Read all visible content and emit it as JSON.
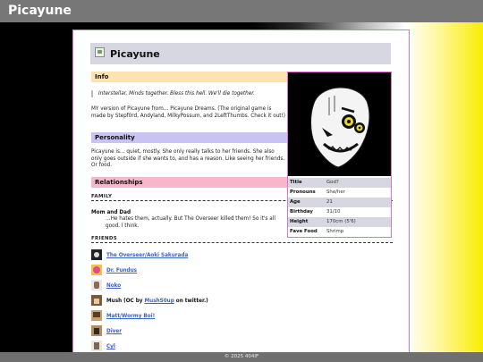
{
  "site": {
    "title": "Picayune"
  },
  "page": {
    "title": "Picayune"
  },
  "info": {
    "heading": "Info",
    "quote": "Interstellar, Minds together. Bless this hell. We'll die together.",
    "intro": "MY version of Picayune from… Picayune Dreams. (The original game is made by Stepf0rd, Andyland, MilkyPossum, and 2LeftThumbs. Check it out!)"
  },
  "personality": {
    "heading": "Personality",
    "text": "Picayune is… quiet, mostly. She only really talks to her friends. She also only goes outside if she wants to, and has a reason. Like seeing her friends. Or food."
  },
  "relationships": {
    "heading": "Relationships",
    "family_label": "FAMILY",
    "family": [
      {
        "name": "Mom and Dad",
        "text": "…He hates them, actually. But The Overseer killed them! So it's all good. I think."
      }
    ],
    "friends_label": "FRIENDS",
    "friends": [
      {
        "name": "The Overseer/Aoki Sakurada",
        "link": true
      },
      {
        "name": "Dr. Fundus",
        "link": true
      },
      {
        "name": "Noko",
        "link": true
      },
      {
        "name": "Mush (OC by ",
        "link_part": "MushS0up",
        "suffix": " on twitter.)",
        "link": false
      },
      {
        "name": "Matt/Wormy Boi!",
        "link": true
      },
      {
        "name": "Diver",
        "link": true
      },
      {
        "name": "Cyl",
        "link": true
      }
    ]
  },
  "profile": {
    "rows": [
      {
        "key": "Title",
        "value": "God?"
      },
      {
        "key": "Pronouns",
        "value": "She/her"
      },
      {
        "key": "Age",
        "value": "21"
      },
      {
        "key": "Birthday",
        "value": "31/10"
      },
      {
        "key": "Height",
        "value": "170cm (5'6)"
      },
      {
        "key": "Fave Food",
        "value": "Shrimp"
      }
    ]
  },
  "footer": {
    "text": "© 2025 404IF"
  },
  "colors": {
    "accent_border": "#e56fd2",
    "link": "#3b62c8",
    "info_bg": "#fde3b2",
    "personality_bg": "#c8c3f3",
    "relationships_bg": "#f7b6c9"
  }
}
